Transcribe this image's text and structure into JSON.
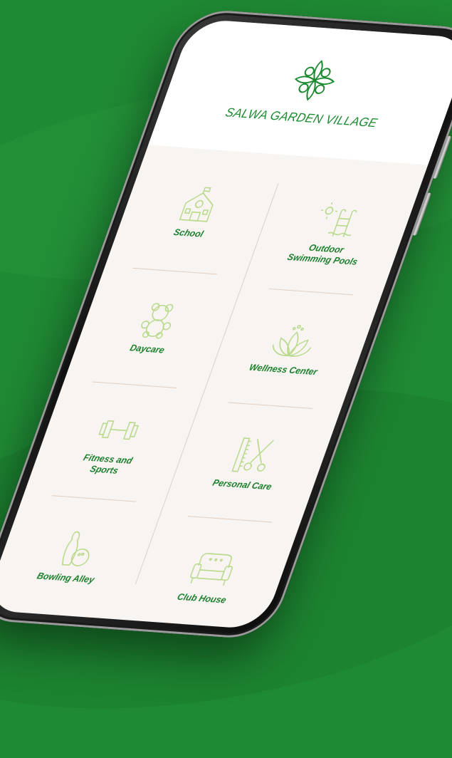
{
  "app": {
    "brand_name": "SALWA GARDEN VILLAGE",
    "logo_icon": "leaf-flower-icon"
  },
  "colors": {
    "background": "#1f8a34",
    "accent": "#1b8a2f",
    "icon_stroke": "#b8d98a",
    "screen_bg": "#f7f4f1"
  },
  "amenities": {
    "left": [
      {
        "label": "School",
        "icon": "school-building-icon"
      },
      {
        "label": "Daycare",
        "icon": "teddy-bear-icon"
      },
      {
        "label": "Fitness and\nSports",
        "icon": "dumbbell-icon"
      },
      {
        "label": "Bowling Alley",
        "icon": "bowling-icon"
      }
    ],
    "right": [
      {
        "label": "Outdoor\nSwimming Pools",
        "icon": "pool-ladder-icon"
      },
      {
        "label": "Wellness Center",
        "icon": "lotus-icon"
      },
      {
        "label": "Personal Care",
        "icon": "comb-scissors-icon"
      },
      {
        "label": "Club House",
        "icon": "sofa-icon"
      }
    ]
  }
}
